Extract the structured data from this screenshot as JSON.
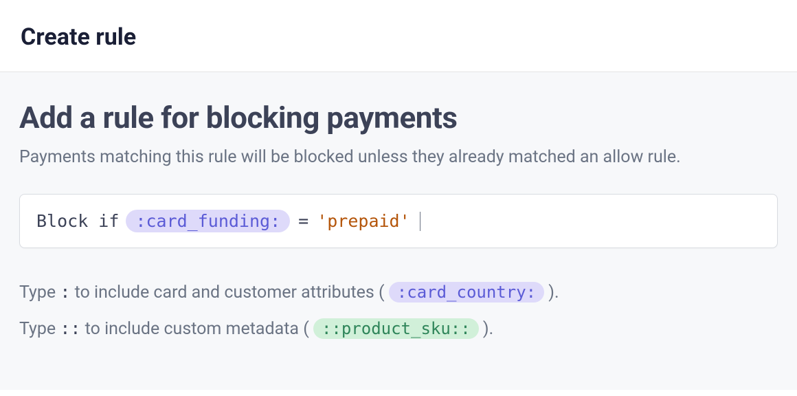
{
  "header": {
    "title": "Create rule"
  },
  "page": {
    "title": "Add a rule for blocking payments",
    "subtitle": "Payments matching this rule will be blocked unless they already matched an allow rule."
  },
  "editor": {
    "keyword": "Block if",
    "attribute_token": ":card_funding:",
    "operator": "=",
    "value": "'prepaid'"
  },
  "hints": {
    "line1_prefix": "Type ",
    "line1_code": ":",
    "line1_mid": " to include card and customer attributes ( ",
    "line1_pill": ":card_country:",
    "line1_suffix": " ).",
    "line2_prefix": "Type ",
    "line2_code": "::",
    "line2_mid": " to include custom metadata ( ",
    "line2_pill": "::product_sku::",
    "line2_suffix": " )."
  }
}
